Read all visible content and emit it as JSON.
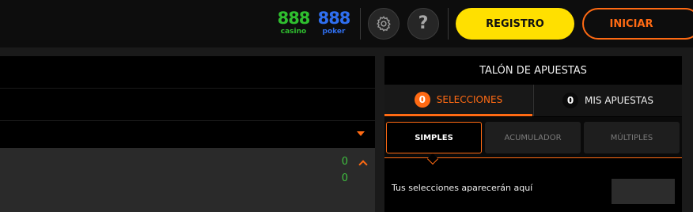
{
  "header": {
    "brands": {
      "casino": {
        "number": "888",
        "label": "casino",
        "color": "#2fbf2f"
      },
      "poker": {
        "number": "888",
        "label": "poker",
        "color": "#2f6ff0"
      }
    },
    "settings_icon": "gear-icon",
    "help_icon": "help-icon",
    "help_glyph": "?",
    "register_label": "REGISTRO",
    "login_label": "INICIAR",
    "accent_color": "#ff6a13",
    "register_color": "#ffe000"
  },
  "markets": {
    "dropdown_icon": "caret-down-icon",
    "collapse_icon": "caret-up-icon",
    "values": [
      "0",
      "0"
    ],
    "value_color": "#3fbf3f"
  },
  "betslip": {
    "title": "TALÓN DE APUESTAS",
    "tabs": [
      {
        "count": "0",
        "label": "SELECCIONES",
        "active": true
      },
      {
        "count": "0",
        "label": "MIS APUESTAS",
        "active": false
      }
    ],
    "types": [
      "SIMPLES",
      "ACUMULADOR",
      "MÚLTIPLES"
    ],
    "active_type": "SIMPLES",
    "empty_message": "Tus selecciones aparecerán aquí"
  }
}
